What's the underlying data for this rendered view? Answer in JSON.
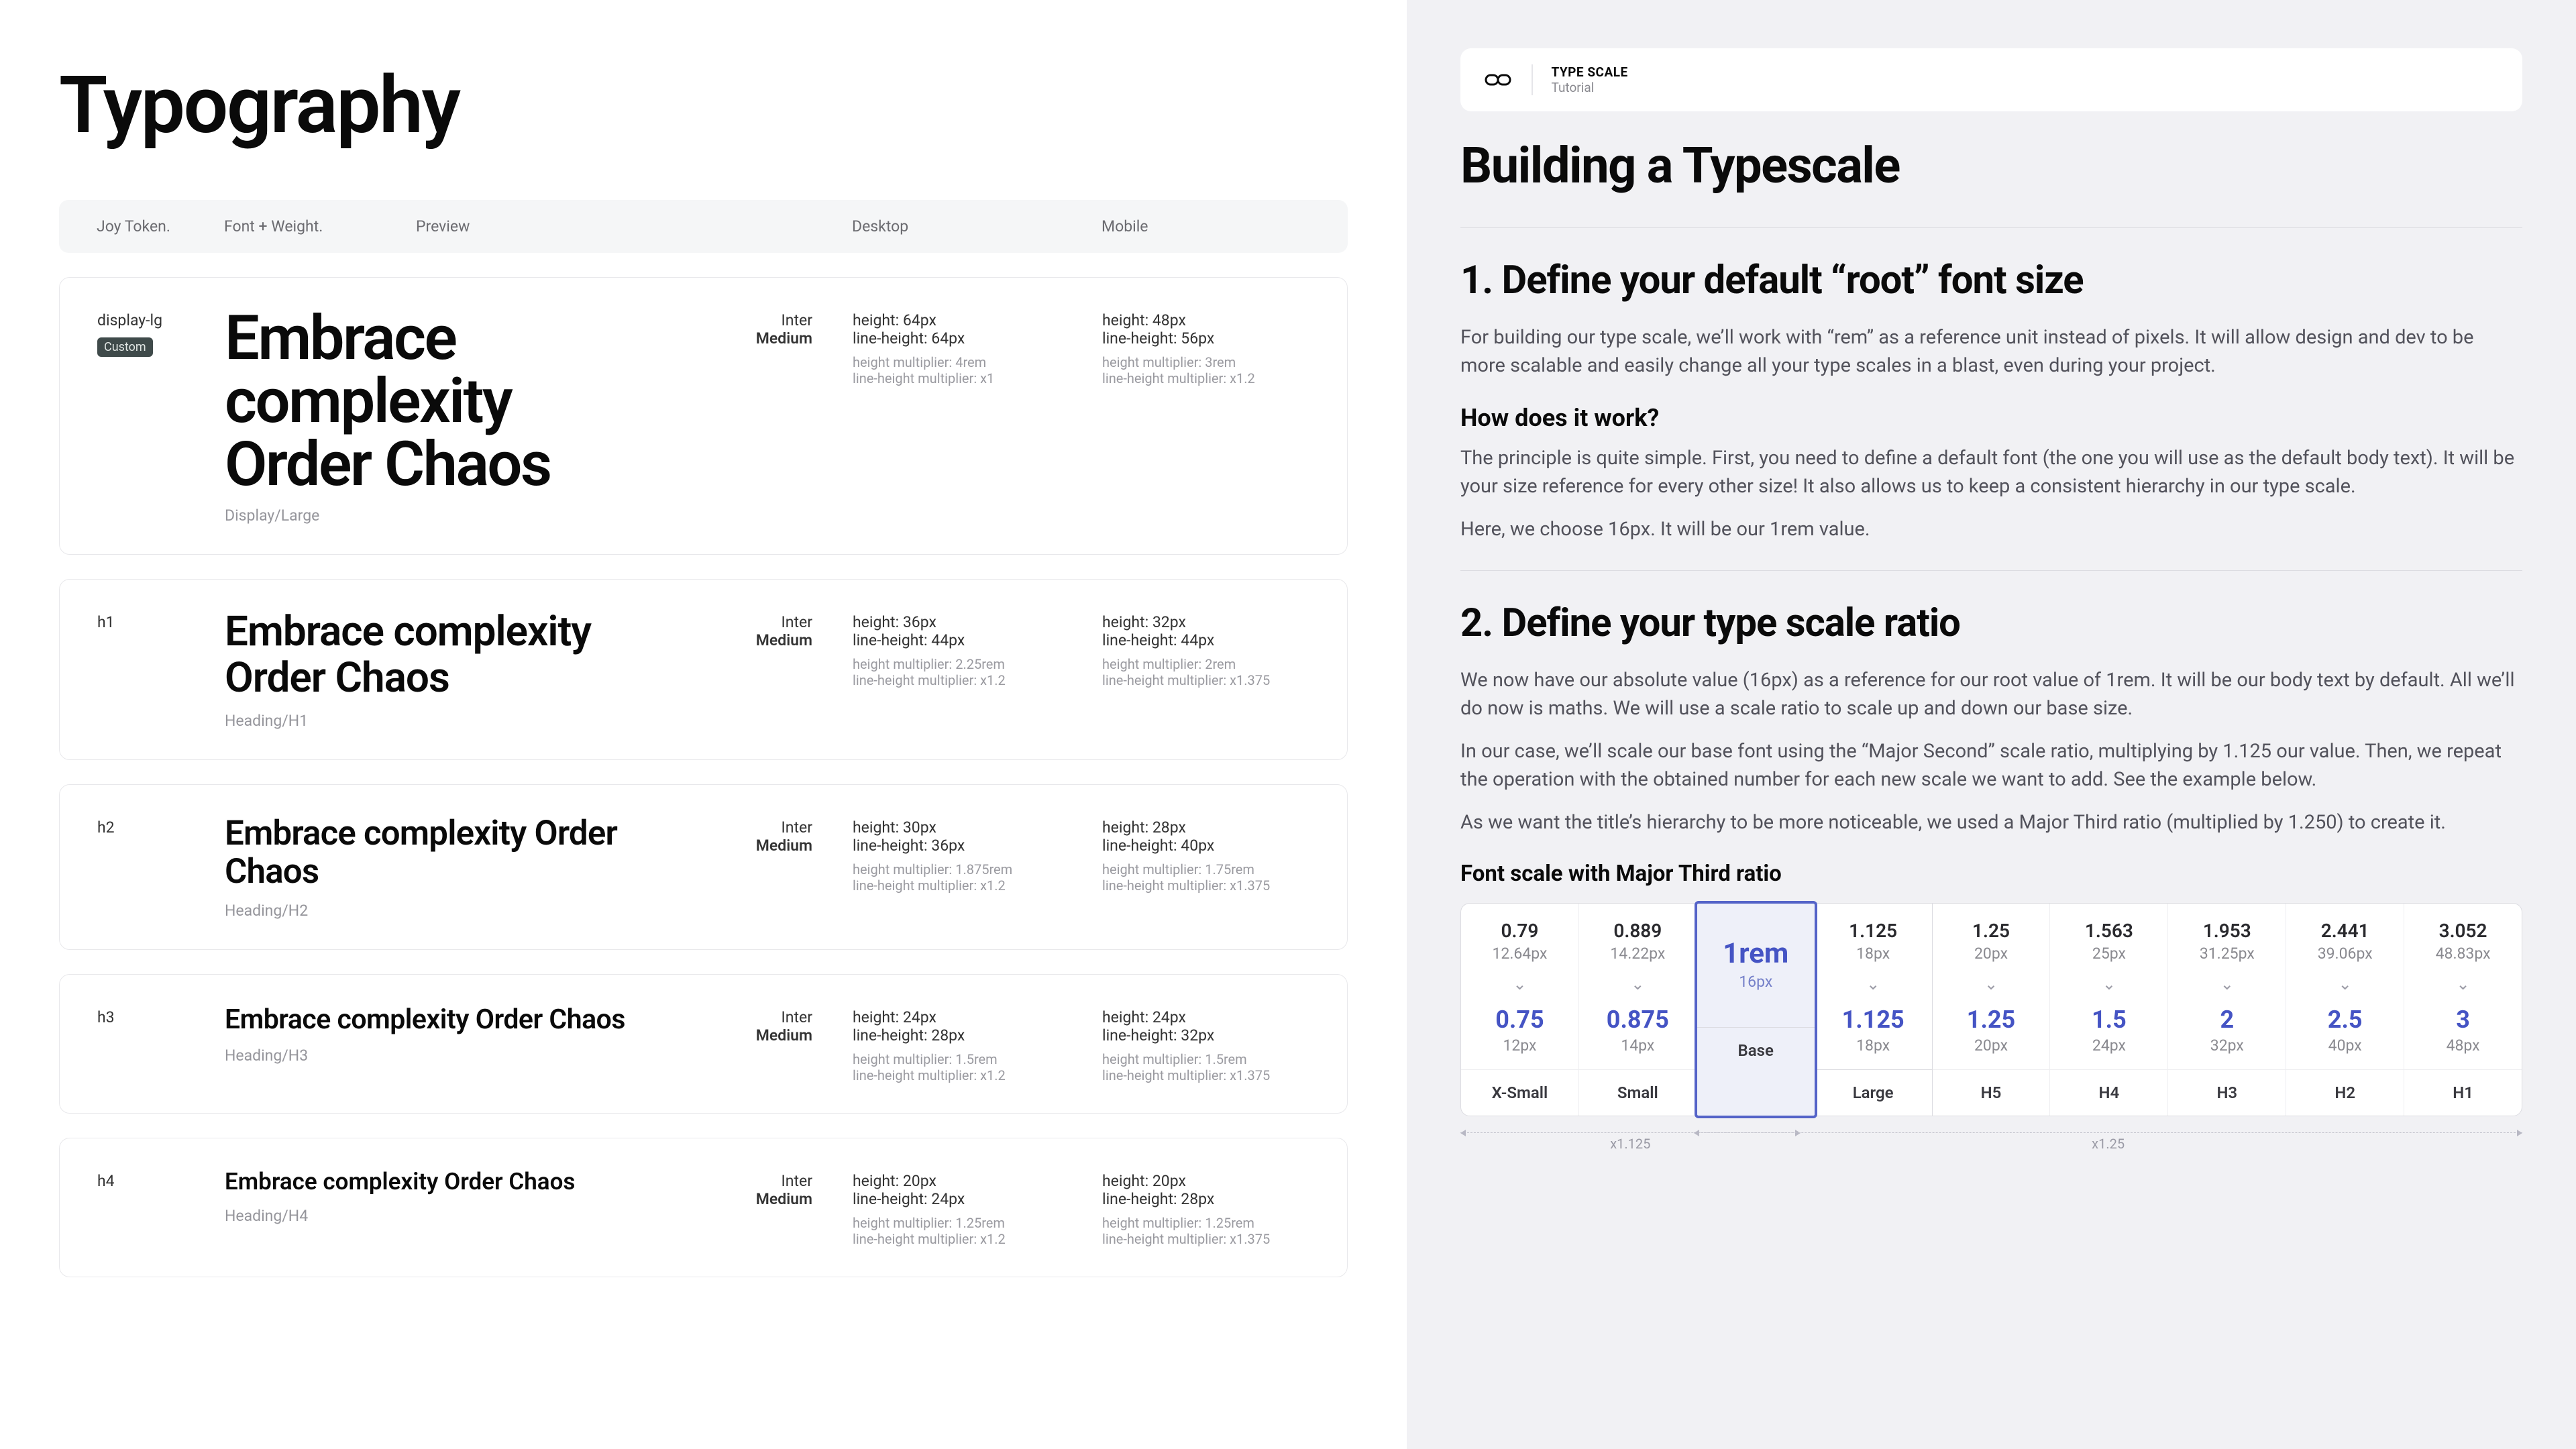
{
  "page_title": "Typography",
  "table_headers": {
    "token": "Joy Token.",
    "font": "Font + Weight.",
    "preview": "Preview",
    "desktop": "Desktop",
    "mobile": "Mobile"
  },
  "sample_text": "Embrace complexity Order Chaos",
  "badge_custom": "Custom",
  "rows": [
    {
      "token": "display-lg",
      "custom": true,
      "sample_class": "sample-lg",
      "category": "Display/Large",
      "font_family": "Inter",
      "font_weight": "Medium",
      "desktop": {
        "height": "height: 64px",
        "lh": "line-height: 64px",
        "hm": "height multiplier: 4rem",
        "lhm": "line-height multiplier: x1"
      },
      "mobile": {
        "height": "height: 48px",
        "lh": "line-height: 56px",
        "hm": "height multiplier: 3rem",
        "lhm": "line-height multiplier: x1.2"
      }
    },
    {
      "token": "h1",
      "sample_class": "sample-h1",
      "category": "Heading/H1",
      "font_family": "Inter",
      "font_weight": "Medium",
      "desktop": {
        "height": "height: 36px",
        "lh": "line-height: 44px",
        "hm": "height multiplier: 2.25rem",
        "lhm": "line-height multiplier: x1.2"
      },
      "mobile": {
        "height": "height: 32px",
        "lh": "line-height: 44px",
        "hm": "height multiplier: 2rem",
        "lhm": "line-height multiplier: x1.375"
      }
    },
    {
      "token": "h2",
      "sample_class": "sample-h2",
      "category": "Heading/H2",
      "font_family": "Inter",
      "font_weight": "Medium",
      "desktop": {
        "height": "height: 30px",
        "lh": "line-height: 36px",
        "hm": "height multiplier: 1.875rem",
        "lhm": "line-height multiplier: x1.2"
      },
      "mobile": {
        "height": "height: 28px",
        "lh": "line-height: 40px",
        "hm": "height multiplier: 1.75rem",
        "lhm": "line-height multiplier: x1.375"
      }
    },
    {
      "token": "h3",
      "sample_class": "sample-h3",
      "category": "Heading/H3",
      "font_family": "Inter",
      "font_weight": "Medium",
      "desktop": {
        "height": "height: 24px",
        "lh": "line-height: 28px",
        "hm": "height multiplier: 1.5rem",
        "lhm": "line-height multiplier: x1.2"
      },
      "mobile": {
        "height": "height: 24px",
        "lh": "line-height: 32px",
        "hm": "height multiplier: 1.5rem",
        "lhm": "line-height multiplier: x1.375"
      }
    },
    {
      "token": "h4",
      "sample_class": "sample-h4",
      "category": "Heading/H4",
      "font_family": "Inter",
      "font_weight": "Medium",
      "desktop": {
        "height": "height: 20px",
        "lh": "line-height: 24px",
        "hm": "height multiplier: 1.25rem",
        "lhm": "line-height multiplier: x1.2"
      },
      "mobile": {
        "height": "height: 20px",
        "lh": "line-height: 28px",
        "hm": "height multiplier: 1.25rem",
        "lhm": "line-height multiplier: x1.375"
      }
    }
  ],
  "tutorial": {
    "topbar": {
      "title": "TYPE SCALE",
      "subtitle": "Tutorial"
    },
    "h1": "Building a Typescale",
    "s1": {
      "h": "1. Define your default “root” font size",
      "p1": "For building our type scale, we’ll work with “rem” as a reference unit instead of pixels. It will allow design and dev to be more scalable and easily change all your type scales in a blast, even during your project.",
      "sub": "How does it work?",
      "p2": "The principle is quite simple. First, you need to define a default font (the one you will use as the default body text). It will be your size reference for every other size! It also allows us to keep a consistent hierarchy in our type scale.",
      "p3": "Here, we choose 16px. It will be our 1rem value."
    },
    "s2": {
      "h": "2. Define your type scale ratio",
      "p1": "We now have our absolute value (16px) as a reference for our root value of 1rem. It will be our body text by default. All we’ll do now is maths. We will use a scale ratio to scale up and down our base size.",
      "p2": "In our case, we’ll scale our base font using the “Major Second” scale ratio, multiplying by 1.125 our value. Then, we repeat the operation with the obtained number for each new scale we want to add. See the example below.",
      "p3": "As we want the title’s hierarchy to be more noticeable, we used a Major Third ratio (multiplied by 1.250) to create it."
    },
    "scale_header": "Font scale with Major Third ratio",
    "scale_cols": [
      {
        "top": "0.79",
        "top_sub": "12.64px",
        "bot": "0.75",
        "bot_sub": "12px",
        "foot": "X-Small"
      },
      {
        "top": "0.889",
        "top_sub": "14.22px",
        "bot": "0.875",
        "bot_sub": "14px",
        "foot": "Small"
      },
      {
        "base": true,
        "main": "1rem",
        "sub": "16px",
        "foot": "Base"
      },
      {
        "top": "1.125",
        "top_sub": "18px",
        "bot": "1.125",
        "bot_sub": "18px",
        "foot": "Large"
      },
      {
        "top": "1.25",
        "top_sub": "20px",
        "bot": "1.25",
        "bot_sub": "20px",
        "foot": "H5"
      },
      {
        "top": "1.563",
        "top_sub": "25px",
        "bot": "1.5",
        "bot_sub": "24px",
        "foot": "H4"
      },
      {
        "top": "1.953",
        "top_sub": "31.25px",
        "bot": "2",
        "bot_sub": "32px",
        "foot": "H3"
      },
      {
        "top": "2.441",
        "top_sub": "39.06px",
        "bot": "2.5",
        "bot_sub": "40px",
        "foot": "H2"
      },
      {
        "top": "3.052",
        "top_sub": "48.83px",
        "bot": "3",
        "bot_sub": "48px",
        "foot": "H1"
      }
    ],
    "arrows": {
      "a1": "x1.125",
      "a2": "x1.25"
    }
  },
  "chart_data": {
    "type": "table",
    "title": "Font scale with Major Third ratio",
    "columns": [
      "X-Small",
      "Small",
      "Base",
      "Large",
      "H5",
      "H4",
      "H3",
      "H2",
      "H1"
    ],
    "series": [
      {
        "name": "exact_rem",
        "values": [
          0.79,
          0.889,
          1,
          1.125,
          1.25,
          1.563,
          1.953,
          2.441,
          3.052
        ]
      },
      {
        "name": "exact_px",
        "values": [
          12.64,
          14.22,
          16,
          18,
          20,
          25,
          31.25,
          39.06,
          48.83
        ]
      },
      {
        "name": "rounded_rem",
        "values": [
          0.75,
          0.875,
          1,
          1.125,
          1.25,
          1.5,
          2,
          2.5,
          3
        ]
      },
      {
        "name": "rounded_px",
        "values": [
          12,
          14,
          16,
          18,
          20,
          24,
          32,
          40,
          48
        ]
      }
    ],
    "ratios": {
      "body": "x1.125",
      "headings": "x1.25"
    }
  }
}
